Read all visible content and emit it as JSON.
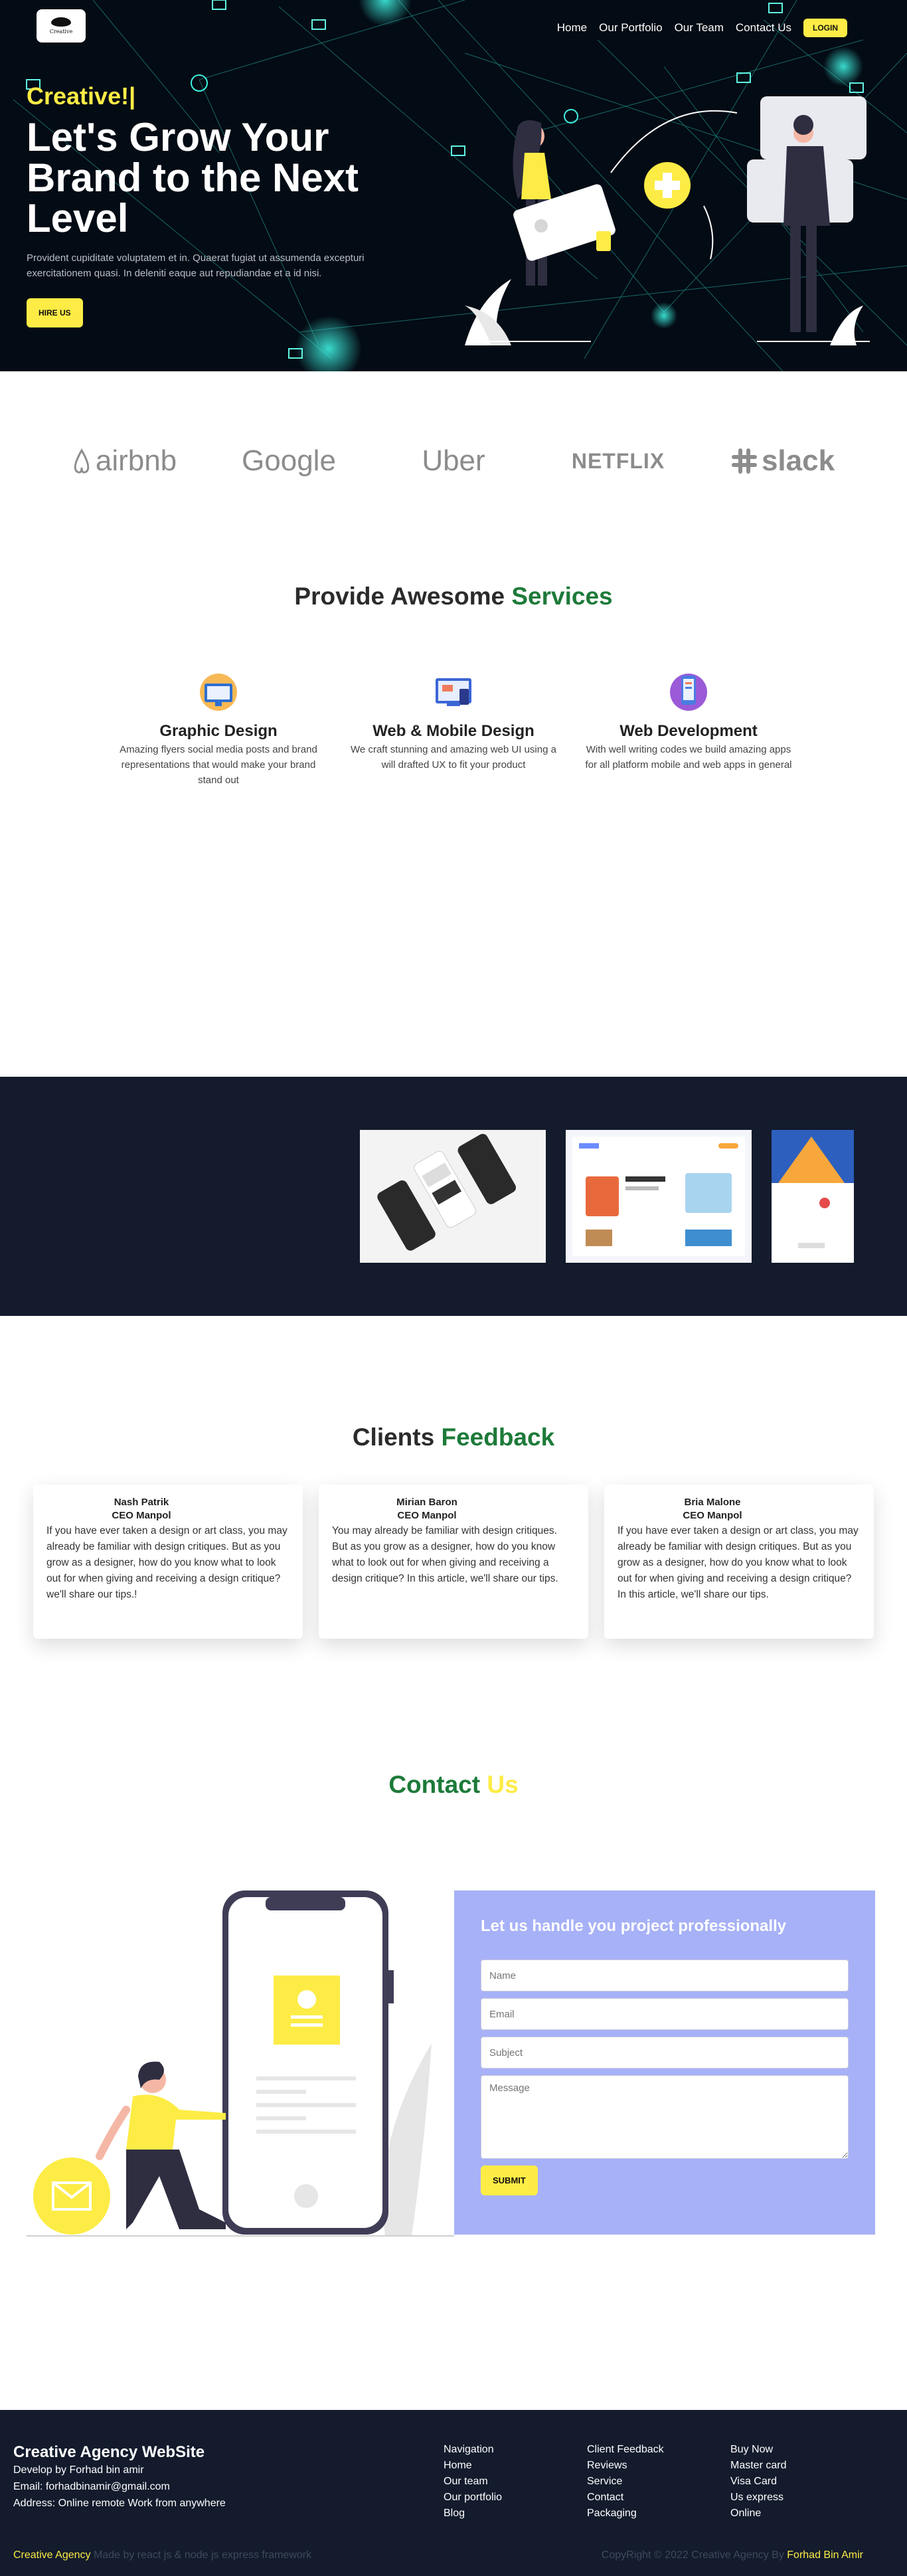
{
  "brand": {
    "logo_text": "Creative"
  },
  "nav": {
    "items": [
      "Home",
      "Our Portfolio",
      "Our Team",
      "Contact Us"
    ],
    "login": "LOGIN"
  },
  "hero": {
    "tagline": "Creative!|",
    "title_line1": "Let's Grow Your",
    "title_line2": "Brand to the Next",
    "title_line3": "Level",
    "description": "Provident cupiditate voluptatem et in. Quaerat fugiat ut assumenda excepturi exercitationem quasi. In deleniti eaque aut repudiandae et a id nisi.",
    "cta": "HIRE US"
  },
  "partners": [
    "airbnb",
    "Google",
    "Uber",
    "NETFLIX",
    "slack"
  ],
  "services": {
    "title_a": "Provide Awesome",
    "title_b": "Services",
    "items": [
      {
        "title": "Graphic Design",
        "text": "Amazing flyers social media posts and brand representations that would make your brand stand out"
      },
      {
        "title": "Web & Mobile Design",
        "text": "We craft stunning and amazing web UI using a will drafted UX to fit your product"
      },
      {
        "title": "Web Development",
        "text": "With well writing codes we build amazing apps for all platform mobile and web apps in general"
      }
    ]
  },
  "feedback": {
    "title_a": "Clients",
    "title_b": "Feedback",
    "items": [
      {
        "name": "Nash Patrik",
        "role": "CEO Manpol",
        "text": "If you have ever taken a design or art class, you may already be familiar with design critiques. But as you grow as a designer, how do you know what to look out for when giving and receiving a design critique? we'll share our tips.!"
      },
      {
        "name": "Mirian Baron",
        "role": "CEO Manpol",
        "text": "You may already be familiar with design critiques. But as you grow as a designer, how do you know what to look out for when giving and receiving a design critique? In this article, we'll share our tips."
      },
      {
        "name": "Bria Malone",
        "role": "CEO Manpol",
        "text": "If you have ever taken a design or art class, you may already be familiar with design critiques. But as you grow as a designer, how do you know what to look out for when giving and receiving a design critique? In this article, we'll share our tips."
      }
    ]
  },
  "contact": {
    "title_a": "Contact",
    "title_b": "Us",
    "form_title": "Let us handle you project professionally",
    "placeholders": {
      "name": "Name",
      "email": "Email",
      "subject": "Subject",
      "message": "Message"
    },
    "submit": "SUBMIT"
  },
  "footer": {
    "title": "Creative Agency WebSite",
    "line1": "Develop by Forhad bin amir",
    "line2": "Email: forhadbinamir@gmail.com",
    "line3": "Address: Online remote Work from anywhere",
    "col1": [
      "Navigation",
      "Home",
      "Our team",
      "Our portfolio",
      "Blog"
    ],
    "col2": [
      "Client Feedback",
      "Reviews",
      "Service",
      "Contact",
      "Packaging"
    ],
    "col3": [
      "Buy Now",
      "Master card",
      "Visa Card",
      "Us express",
      "Online"
    ],
    "bottom_brand": "Creative Agency",
    "bottom_note": "Made by react js & node js express framework",
    "copyright": "CopyRight © 2022 Creative Agency By",
    "author": "Forhad Bin Amir"
  },
  "colors": {
    "accent": "#fdec45",
    "dark": "#131b2d",
    "green": "#1d7a39",
    "form_bg": "#a7b1f7"
  }
}
